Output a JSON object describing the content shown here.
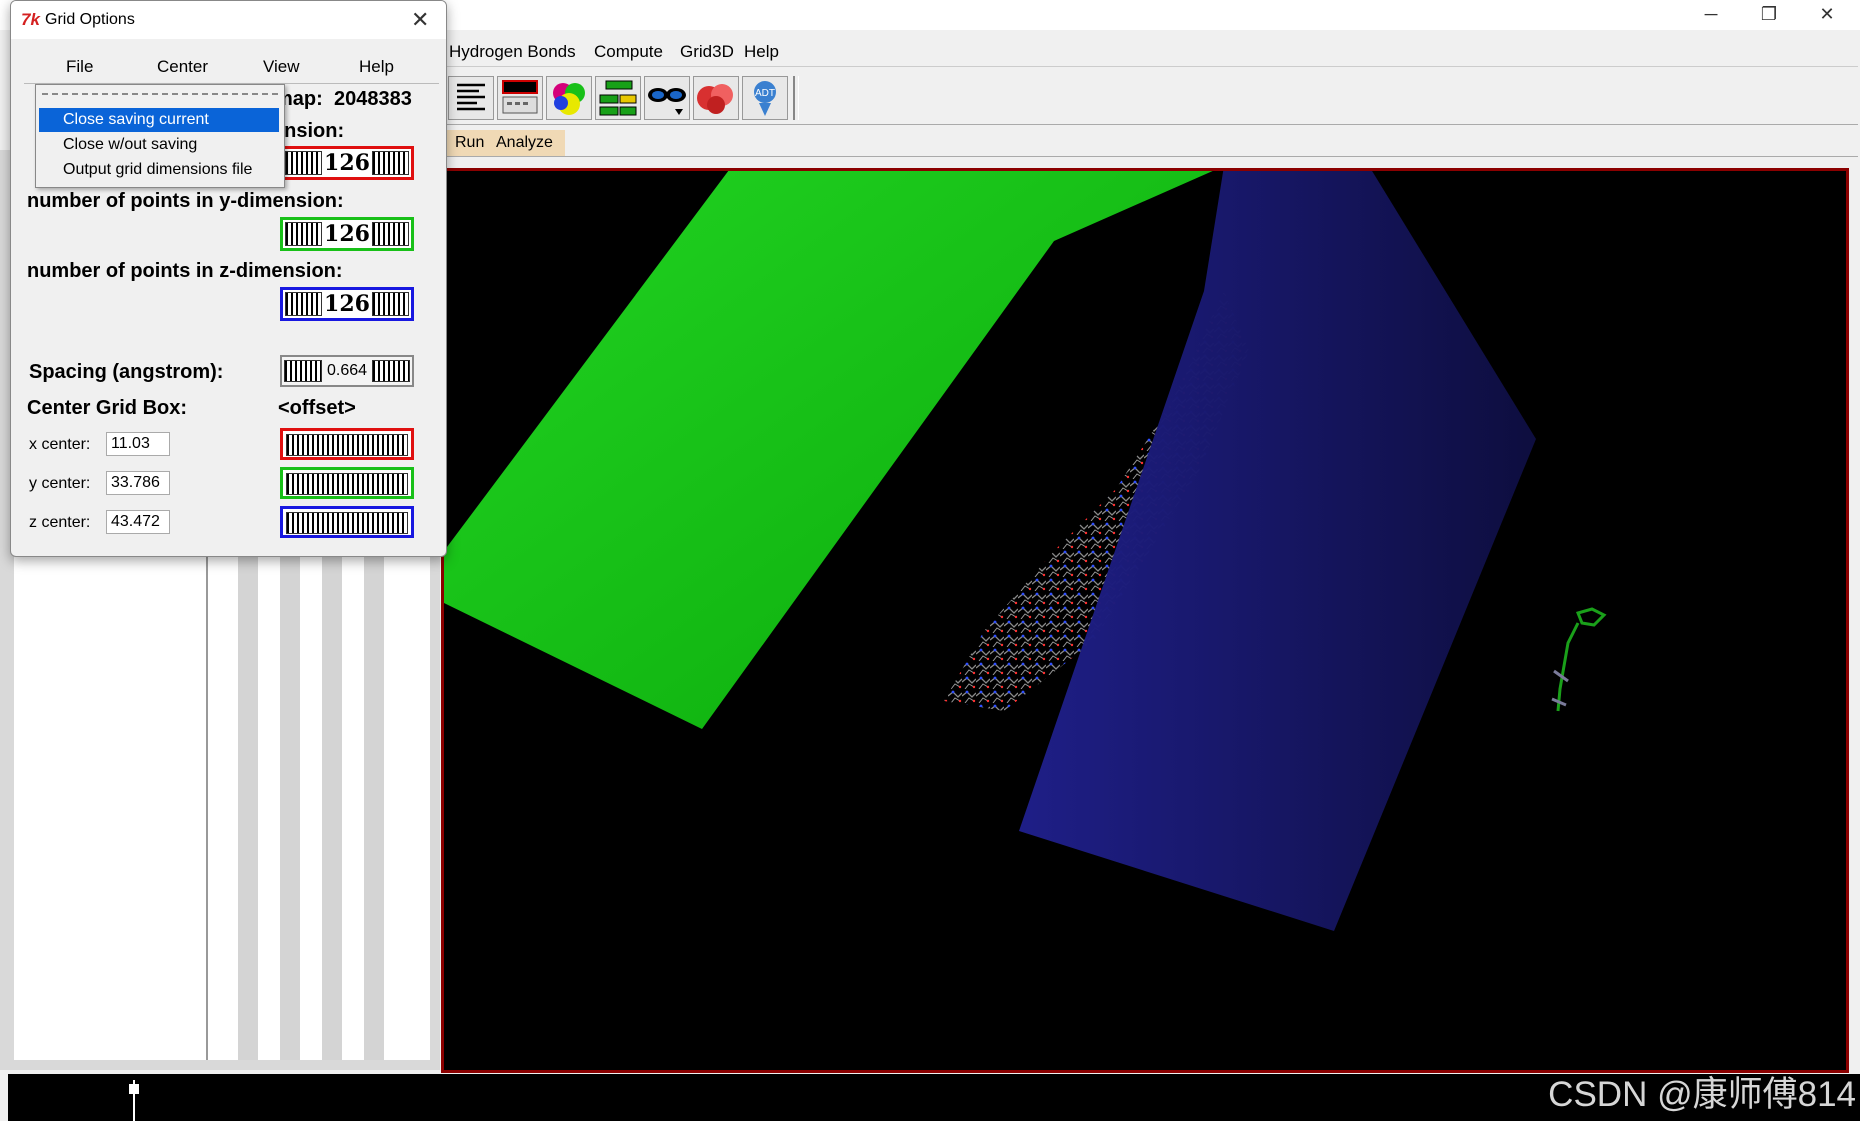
{
  "main_window": {
    "controls": {
      "minimize": "─",
      "restore": "❐",
      "close": "✕"
    },
    "menu": [
      "Hydrogen Bonds",
      "Compute",
      "Grid3D",
      "Help"
    ],
    "toolbar_icons": [
      "align-icon",
      "display-icon",
      "molecule-color-icon",
      "tree-icon",
      "stereo-glasses-icon",
      "surface-icon",
      "autodock-icon"
    ],
    "tabs": [
      "Run",
      "Analyze"
    ],
    "tab_partial_label": "Run"
  },
  "dialog": {
    "title": "Grid Options",
    "logo": "7k",
    "close_glyph": "✕",
    "menu": [
      "File",
      "Center",
      "View",
      "Help"
    ],
    "file_menu": {
      "items": [
        "Close saving current",
        "Close w/out saving",
        "Output grid dimensions file"
      ],
      "selected_index": 0
    },
    "map_label": "map:",
    "map_value": "2048383",
    "x_dim_label_partial": "ension:",
    "y_dim_label": "number of points in y-dimension:",
    "z_dim_label": "number of points in z-dimension:",
    "x_points": "126",
    "y_points": "126",
    "z_points": "126",
    "spacing_label": "Spacing (angstrom):",
    "spacing_value": "0.664",
    "center_label": "Center Grid Box:",
    "offset_label": "<offset>",
    "x_center_label": "x center:",
    "x_center_value": "11.03",
    "y_center_label": "y center:",
    "y_center_value": "33.786",
    "z_center_label": "z center:",
    "z_center_value": "43.472"
  },
  "colors": {
    "x_axis": "#e01010",
    "y_axis": "#18c018",
    "z_axis": "#1818e0",
    "green_plane": "#12c812",
    "blue_plane": "#1a1a78",
    "viewer_bg": "#000000",
    "viewer_border": "#8b0000",
    "selection": "#0a64d8"
  },
  "watermark": "CSDN @康师傅814"
}
